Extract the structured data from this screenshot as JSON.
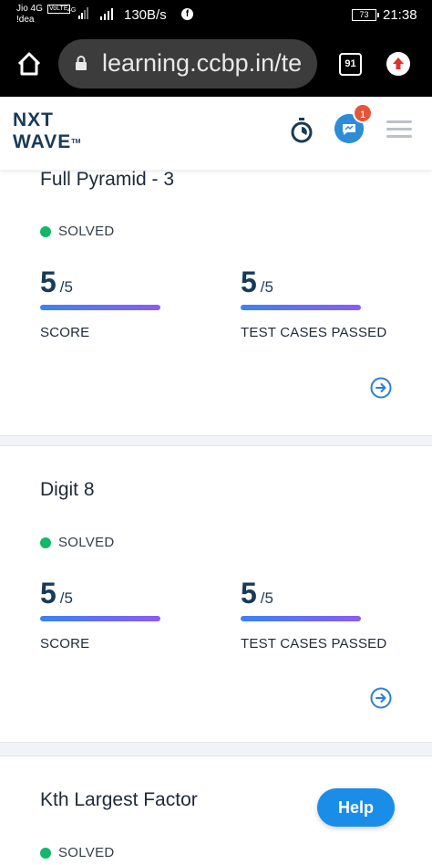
{
  "status_bar": {
    "carrier_1": "Jio 4G",
    "carrier_2": "!dea",
    "volte": "VoLTE",
    "network": "4G",
    "speed": "130B/s",
    "battery": "73",
    "time": "21:38"
  },
  "browser": {
    "url": "learning.ccbp.in/te",
    "tab_count": "91"
  },
  "header": {
    "logo_line1": "NXT",
    "logo_line2": "WAVE",
    "logo_tm": "TM",
    "notification_count": "1"
  },
  "cards": [
    {
      "title": "Full Pyramid - 3",
      "status": "SOLVED",
      "score_value": "5",
      "score_total": "/5",
      "score_label": "SCORE",
      "tests_value": "5",
      "tests_total": "/5",
      "tests_label": "TEST CASES PASSED"
    },
    {
      "title": "Digit 8",
      "status": "SOLVED",
      "score_value": "5",
      "score_total": "/5",
      "score_label": "SCORE",
      "tests_value": "5",
      "tests_total": "/5",
      "tests_label": "TEST CASES PASSED"
    },
    {
      "title": "Kth Largest Factor",
      "status": "SOLVED"
    }
  ],
  "help_label": "Help",
  "colors": {
    "solved_green": "#12b76a",
    "brand_navy": "#183b56",
    "accent_blue": "#1a8de8",
    "badge_red": "#e4553c"
  }
}
